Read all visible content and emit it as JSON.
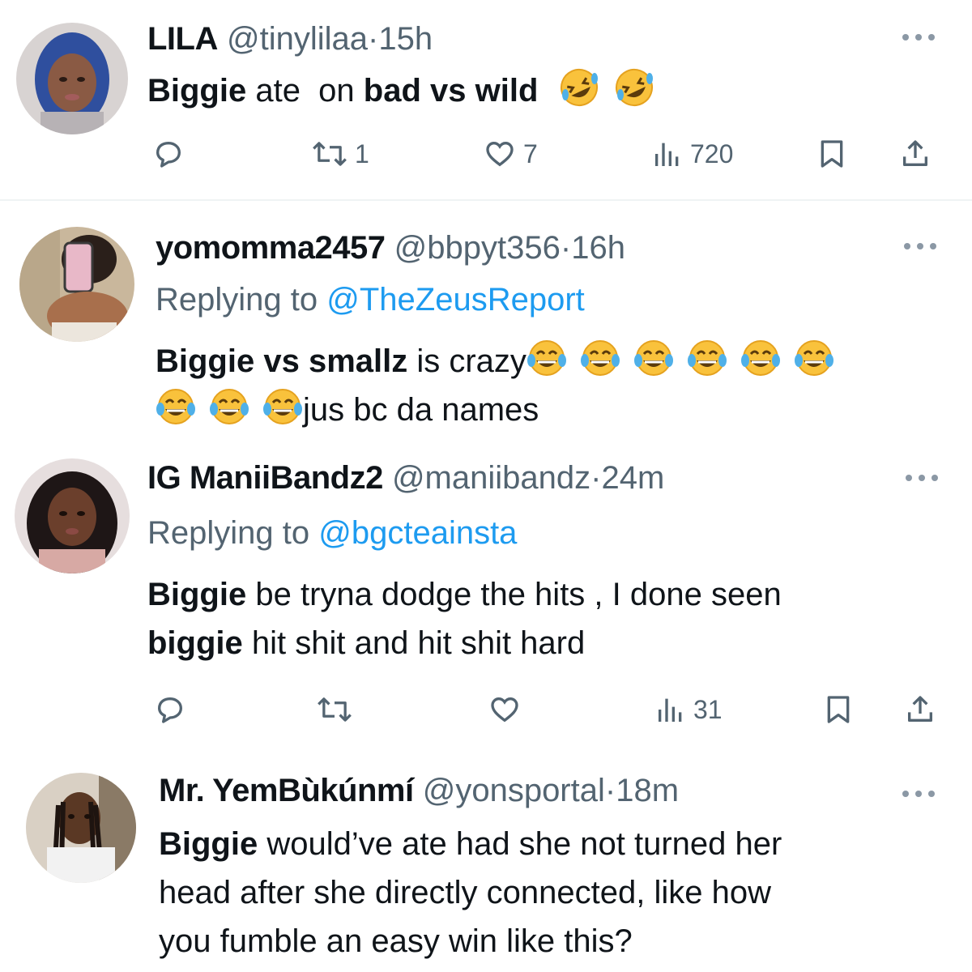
{
  "tweets": [
    {
      "name": "LILA",
      "handle": "@tinylilaa",
      "dot": "·",
      "time": "15h",
      "body_bold_1": "Biggie",
      "body_plain_1": " ate  on ",
      "body_bold_2": "bad vs wild",
      "emoji": [
        "rofl-emoji",
        "rofl-emoji"
      ],
      "stats": {
        "retweets": "1",
        "likes": "7",
        "views": "720"
      }
    },
    {
      "name": "yomomma2457",
      "handle": "@bbpyt356",
      "dot": "·",
      "time": "16h",
      "replying_prefix": "Replying to ",
      "replying_to": "@TheZeusReport",
      "body_bold_1": "Biggie vs smallz",
      "body_plain_1": " is crazy",
      "body_plain_2": "jus bc da names",
      "emoji": [
        "joy-emoji",
        "joy-emoji",
        "joy-emoji",
        "joy-emoji",
        "joy-emoji",
        "joy-emoji",
        "joy-emoji",
        "joy-emoji",
        "joy-emoji"
      ]
    },
    {
      "name": "IG ManiiBandz2",
      "handle": "@maniibandz",
      "dot": "·",
      "time": "24m",
      "replying_prefix": "Replying to ",
      "replying_to": "@bgcteainsta",
      "body_bold_1": "Biggie",
      "body_plain_1": " be tryna dodge the hits , I done seen",
      "body_bold_2": "biggie",
      "body_plain_2": " hit shit and hit shit hard",
      "stats": {
        "retweets": "",
        "likes": "",
        "views": "31"
      }
    },
    {
      "name": "Mr. YemBùkúnmí",
      "handle": "@yonsportal",
      "dot": "·",
      "time": "18m",
      "body_bold_1": "Biggie",
      "body_plain_1": " would’ve ate had she not turned her",
      "body_plain_2": "head after she directly connected, like how",
      "body_plain_3": "you fumble an easy win like this?"
    }
  ],
  "icons": [
    "reply-icon",
    "retweet-icon",
    "like-icon",
    "views-icon",
    "bookmark-icon",
    "share-icon",
    "more-icon"
  ],
  "colors": {
    "text": "#0f1419",
    "secondary": "#536471",
    "link": "#1d9bf0",
    "separator": "#eff3f4"
  }
}
